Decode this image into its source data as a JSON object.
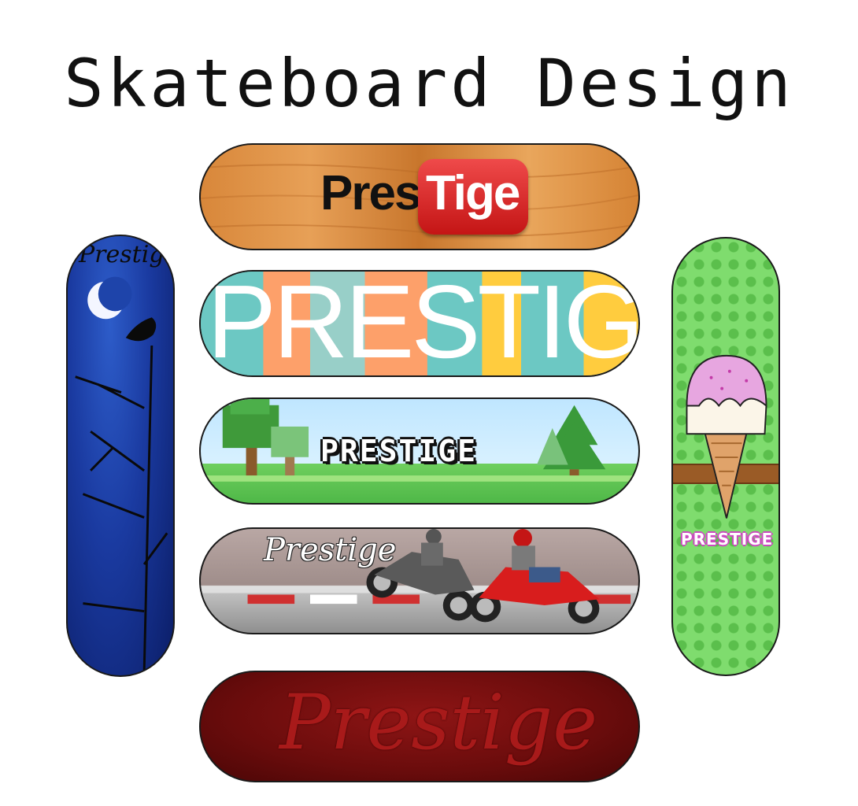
{
  "page": {
    "title": "Skateboard Design"
  },
  "boards": {
    "wood": {
      "left_text": "Pres",
      "badge_text": "Tige",
      "badge_color": "#d81d1d"
    },
    "stripes": {
      "text": "PRESTIGE",
      "colors": [
        "#6cc8c3",
        "#fda06a",
        "#98cfc8",
        "#ffcc3e"
      ]
    },
    "pixel": {
      "text": "PRESTIGE"
    },
    "moto": {
      "text": "Prestige"
    },
    "red": {
      "text": "Prestige"
    },
    "night": {
      "text": "Prestige"
    },
    "ice": {
      "text": "PRESTIGE"
    }
  }
}
